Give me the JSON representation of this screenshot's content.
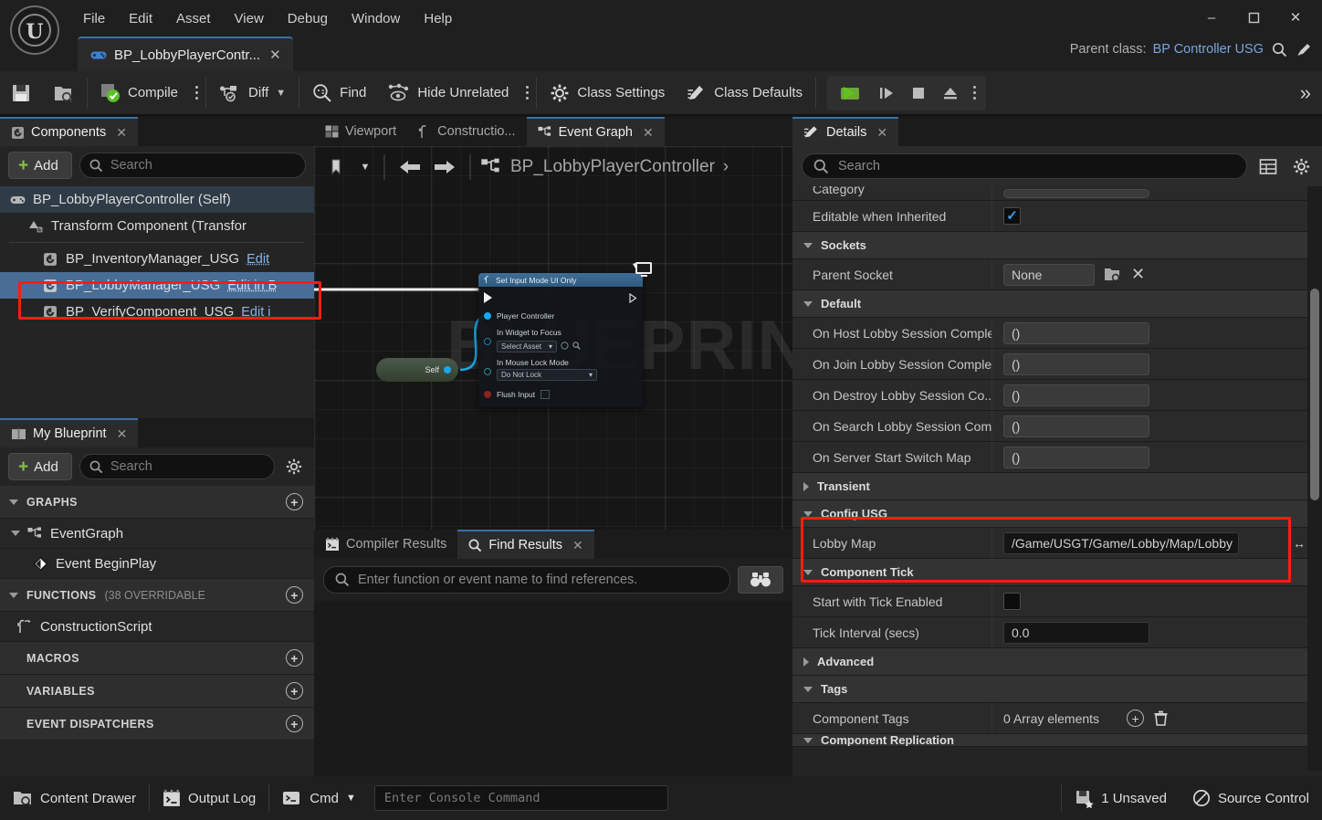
{
  "window": {
    "menus": [
      "File",
      "Edit",
      "Asset",
      "View",
      "Debug",
      "Window",
      "Help"
    ],
    "asset_tab": "BP_LobbyPlayerContr...",
    "asset_tab_icon": "gamepad-icon",
    "minimize": "–",
    "maximize": "☐",
    "close": "✕",
    "parent_class_label": "Parent class:",
    "parent_class_value": "BP Controller USG"
  },
  "toolbar": {
    "save": "",
    "browse": "",
    "compile": "Compile",
    "diff": "Diff",
    "find": "Find",
    "hide_unrelated": "Hide Unrelated",
    "class_settings": "Class Settings",
    "class_defaults": "Class Defaults",
    "overflow": "»"
  },
  "components": {
    "tab_label": "Components",
    "add_label": "Add",
    "search_placeholder": "Search",
    "items": [
      {
        "label": "BP_LobbyPlayerController (Self)",
        "icon": "gamepad-icon",
        "state": "self",
        "action": ""
      },
      {
        "label": "Transform Component (Transfor",
        "icon": "transform-icon",
        "state": "child",
        "action": ""
      },
      {
        "label": "BP_InventoryManager_USG",
        "icon": "component-icon",
        "state": "normal",
        "action": "Edit"
      },
      {
        "label": "BP_LobbyManager_USG",
        "icon": "component-icon",
        "state": "selected",
        "action": "Edit in B"
      },
      {
        "label": "BP_VerifyComponent_USG",
        "icon": "component-icon",
        "state": "normal",
        "action": "Edit i"
      }
    ]
  },
  "my_blueprint": {
    "tab_label": "My Blueprint",
    "add_label": "Add",
    "search_placeholder": "Search",
    "settings_icon": "gear-icon",
    "sections": [
      {
        "type": "section",
        "label": "GRAPHS",
        "suffix": "",
        "expanded": true
      },
      {
        "type": "item",
        "label": "EventGraph",
        "icon": "graph-icon",
        "indent": 1,
        "expandable": true
      },
      {
        "type": "item",
        "label": "Event BeginPlay",
        "icon": "event-node-icon",
        "indent": 2,
        "expandable": false
      },
      {
        "type": "section",
        "label": "FUNCTIONS",
        "suffix": "(38 OVERRIDABLE",
        "expanded": true
      },
      {
        "type": "item",
        "label": "ConstructionScript",
        "icon": "function-icon",
        "indent": 1,
        "expandable": false
      },
      {
        "type": "section",
        "label": "MACROS",
        "suffix": "",
        "expanded": false
      },
      {
        "type": "section",
        "label": "VARIABLES",
        "suffix": "",
        "expanded": false
      },
      {
        "type": "section",
        "label": "EVENT DISPATCHERS",
        "suffix": "",
        "expanded": false
      }
    ]
  },
  "graph": {
    "tabs": [
      {
        "label": "Viewport",
        "icon": "viewport-icon",
        "active": false,
        "closable": false
      },
      {
        "label": "Constructio...",
        "icon": "function-icon",
        "active": false,
        "closable": false
      },
      {
        "label": "Event Graph",
        "icon": "graph-icon",
        "active": true,
        "closable": true
      }
    ],
    "breadcrumb": "BP_LobbyPlayerController",
    "watermark": "BLUEPRINT",
    "node": {
      "title": "Set Input Mode UI Only",
      "pins": [
        {
          "label": "Player Controller",
          "type": "object"
        },
        {
          "label": "In Widget to Focus",
          "type": "object",
          "value": "Select Asset"
        },
        {
          "label": "In Mouse Lock Mode",
          "type": "enum",
          "value": "Do Not Lock"
        },
        {
          "label": "Flush Input",
          "type": "bool",
          "value": false
        }
      ]
    },
    "self_node_label": "Self"
  },
  "results": {
    "tabs": [
      {
        "label": "Compiler Results",
        "icon": "compiler-icon",
        "active": false,
        "closable": false
      },
      {
        "label": "Find Results",
        "icon": "search-icon",
        "active": true,
        "closable": true
      }
    ],
    "find_placeholder": "Enter function or event name to find references.",
    "find_button_icon": "binoculars-icon"
  },
  "details": {
    "tab_label": "Details",
    "search_placeholder": "Search",
    "grid_icon": "columns-icon",
    "settings_icon": "gear-icon",
    "rows": [
      {
        "kind": "prop",
        "name": "Category",
        "value": "",
        "control": "combo-clipped"
      },
      {
        "kind": "prop",
        "name": "Editable when Inherited",
        "value": "",
        "control": "checkbox",
        "checked": true
      },
      {
        "kind": "category",
        "name": "Sockets",
        "expanded": true
      },
      {
        "kind": "prop",
        "name": "Parent Socket",
        "value": "None",
        "control": "socket"
      },
      {
        "kind": "category",
        "name": "Default",
        "expanded": true
      },
      {
        "kind": "prop",
        "name": "On Host Lobby Session Comple...",
        "value": "()",
        "control": "text"
      },
      {
        "kind": "prop",
        "name": "On Join Lobby Session Comple...",
        "value": "()",
        "control": "text"
      },
      {
        "kind": "prop",
        "name": "On Destroy Lobby Session Co...",
        "value": "()",
        "control": "text"
      },
      {
        "kind": "prop",
        "name": "On Search Lobby Session Com...",
        "value": "()",
        "control": "text"
      },
      {
        "kind": "prop",
        "name": "On Server Start Switch Map",
        "value": "()",
        "control": "text"
      },
      {
        "kind": "category",
        "name": "Transient",
        "expanded": false
      },
      {
        "kind": "category",
        "name": "Config USG",
        "expanded": true,
        "highlight": true
      },
      {
        "kind": "prop",
        "name": "Lobby Map",
        "value": "/Game/USGT/Game/Lobby/Map/Lobby",
        "control": "wide-text",
        "highlight": true
      },
      {
        "kind": "category",
        "name": "Component Tick",
        "expanded": true
      },
      {
        "kind": "prop",
        "name": "Start with Tick Enabled",
        "value": "",
        "control": "checkbox",
        "checked": false
      },
      {
        "kind": "prop",
        "name": "Tick Interval (secs)",
        "value": "0.0",
        "control": "number"
      },
      {
        "kind": "category",
        "name": "Advanced",
        "expanded": false
      },
      {
        "kind": "category",
        "name": "Tags",
        "expanded": true
      },
      {
        "kind": "prop",
        "name": "Component Tags",
        "value": "0 Array elements",
        "control": "array"
      },
      {
        "kind": "category",
        "name": "Component Replication",
        "expanded": true
      }
    ]
  },
  "statusbar": {
    "content_drawer": "Content Drawer",
    "output_log": "Output Log",
    "cmd": "Cmd",
    "console_placeholder": "Enter Console Command",
    "unsaved": "1 Unsaved",
    "source_control": "Source Control"
  },
  "colors": {
    "accent_blue": "#3a6fa8",
    "selection_blue": "#4a6d96",
    "link_blue": "#8ab4e8",
    "annotation_red": "#fa1e0e",
    "add_green": "#86c440",
    "panel_bg": "#242424"
  }
}
